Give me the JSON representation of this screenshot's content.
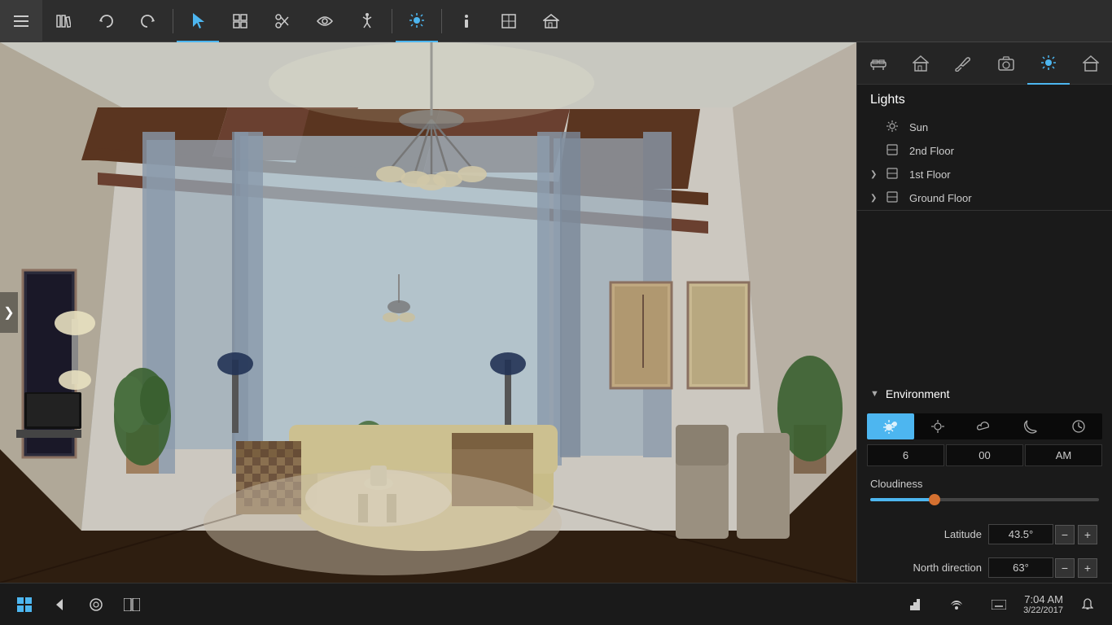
{
  "toolbar": {
    "buttons": [
      {
        "id": "menu",
        "icon": "☰",
        "label": "Menu",
        "active": false
      },
      {
        "id": "library",
        "icon": "📚",
        "label": "Library",
        "active": false
      },
      {
        "id": "undo",
        "icon": "↩",
        "label": "Undo",
        "active": false
      },
      {
        "id": "redo",
        "icon": "↪",
        "label": "Redo",
        "active": false
      },
      {
        "id": "select",
        "icon": "↖",
        "label": "Select",
        "active": true
      },
      {
        "id": "arrange",
        "icon": "⊞",
        "label": "Arrange",
        "active": false
      },
      {
        "id": "scissors",
        "icon": "✂",
        "label": "Cut",
        "active": false
      },
      {
        "id": "eye",
        "icon": "👁",
        "label": "View",
        "active": false
      },
      {
        "id": "walk",
        "icon": "🚶",
        "label": "Walk",
        "active": false
      },
      {
        "id": "sun",
        "icon": "☀",
        "label": "Lights",
        "active": true
      },
      {
        "id": "info",
        "icon": "ℹ",
        "label": "Info",
        "active": false
      },
      {
        "id": "layout",
        "icon": "⊡",
        "label": "Layout",
        "active": false
      },
      {
        "id": "home3d",
        "icon": "⌂",
        "label": "3D Home",
        "active": false
      }
    ]
  },
  "right_panel": {
    "icons": [
      {
        "id": "furniture",
        "icon": "🪑",
        "label": "Furniture",
        "active": false
      },
      {
        "id": "architecture",
        "icon": "🏛",
        "label": "Architecture",
        "active": false
      },
      {
        "id": "paint",
        "icon": "🖌",
        "label": "Paint",
        "active": false
      },
      {
        "id": "camera",
        "icon": "📷",
        "label": "Camera",
        "active": false
      },
      {
        "id": "lighting",
        "icon": "☀",
        "label": "Lighting",
        "active": true
      },
      {
        "id": "house",
        "icon": "🏠",
        "label": "House",
        "active": false
      }
    ],
    "lights": {
      "title": "Lights",
      "items": [
        {
          "id": "sun",
          "label": "Sun",
          "icon": "☀",
          "expandable": false
        },
        {
          "id": "2nd-floor",
          "label": "2nd Floor",
          "icon": "⊟",
          "expandable": false
        },
        {
          "id": "1st-floor",
          "label": "1st Floor",
          "icon": "⊟",
          "expandable": true
        },
        {
          "id": "ground-floor",
          "label": "Ground Floor",
          "icon": "⊟",
          "expandable": true
        }
      ]
    },
    "environment": {
      "title": "Environment",
      "weather_buttons": [
        {
          "id": "clear",
          "icon": "☀☀",
          "label": "Clear sunny",
          "active": true
        },
        {
          "id": "hazy",
          "icon": "☀",
          "label": "Hazy",
          "active": false
        },
        {
          "id": "cloudy",
          "icon": "☁",
          "label": "Cloudy",
          "active": false
        },
        {
          "id": "night",
          "icon": "🌙",
          "label": "Night",
          "active": false
        },
        {
          "id": "clock",
          "icon": "🕐",
          "label": "Custom",
          "active": false
        }
      ],
      "time": {
        "hour": "6",
        "minutes": "00",
        "period": "AM"
      },
      "cloudiness": {
        "label": "Cloudiness",
        "value": 30
      },
      "latitude": {
        "label": "Latitude",
        "value": "43.5°"
      },
      "north_direction": {
        "label": "North direction",
        "value": "63°"
      }
    }
  },
  "taskbar": {
    "start_icon": "⊞",
    "back_icon": "←",
    "circle_icon": "○",
    "multi_icon": "⧉",
    "system_icons": [
      "🔊",
      "🌐",
      "⌨"
    ],
    "clock": {
      "time": "7:04 AM",
      "date": "3/22/2017"
    },
    "notification_icon": "🔔"
  },
  "viewport": {
    "left_arrow": ">"
  }
}
